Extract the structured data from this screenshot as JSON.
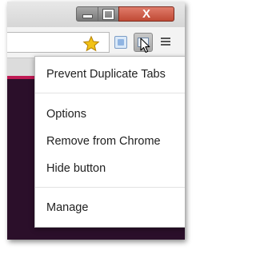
{
  "window": {
    "minimize_label": "minimize",
    "maximize_label": "maximize",
    "close_label": "X"
  },
  "toolbar": {
    "icons": [
      "star-icon",
      "extension-icon",
      "active-extension-icon",
      "cursor-icon",
      "menu-icon"
    ]
  },
  "colors": {
    "close_button": "#c04a35",
    "accent_line": "#c01b55",
    "page_background": "#2b0f2a",
    "star": "#f2c215"
  },
  "menu": {
    "items": [
      {
        "label": "Prevent Duplicate Tabs"
      },
      {
        "label": "Options"
      },
      {
        "label": "Remove from Chrome"
      },
      {
        "label": "Hide button"
      },
      {
        "label": "Manage"
      }
    ]
  }
}
